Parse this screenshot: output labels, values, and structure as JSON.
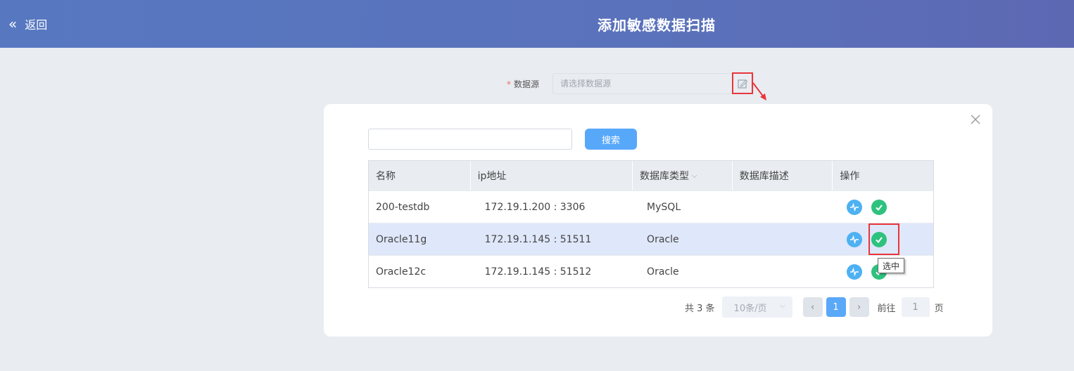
{
  "header": {
    "back_label": "返回",
    "back_icon": "double-chevron-left-icon",
    "title": "添加敏感数据扫描"
  },
  "form": {
    "required_mark": "*",
    "datasource_label": "数据源",
    "datasource_placeholder": "请选择数据源",
    "edit_icon": "edit-icon"
  },
  "dialog": {
    "close_icon": "close-icon",
    "search": {
      "placeholder": "",
      "button_label": "搜索"
    },
    "table": {
      "columns": [
        "名称",
        "ip地址",
        "数据库类型",
        "数据库描述",
        "操作"
      ],
      "rows": [
        {
          "name": "200-testdb",
          "ip": "172.19.1.200 : 3306",
          "type": "MySQL",
          "desc": "",
          "selected": false
        },
        {
          "name": "Oracle11g",
          "ip": "172.19.1.145 : 51511",
          "type": "Oracle",
          "desc": "",
          "selected": true
        },
        {
          "name": "Oracle12c",
          "ip": "172.19.1.145 : 51512",
          "type": "Oracle",
          "desc": "",
          "selected": false
        }
      ],
      "action_icons": [
        "pulse-icon",
        "check-circle-icon"
      ]
    },
    "tooltip": "选中",
    "pagination": {
      "total": "共 3 条",
      "page_size": "10条/页",
      "current_page": "1",
      "goto_label": "前往",
      "goto_value": "1",
      "page_suffix": "页"
    }
  },
  "colors": {
    "header_start": "#5778c1",
    "header_end": "#5d68b3",
    "primary": "#58a8fa",
    "success": "#2ec27e",
    "info": "#4db1f2",
    "highlight": "#e8363b",
    "selected_row": "#dfe7fa"
  }
}
